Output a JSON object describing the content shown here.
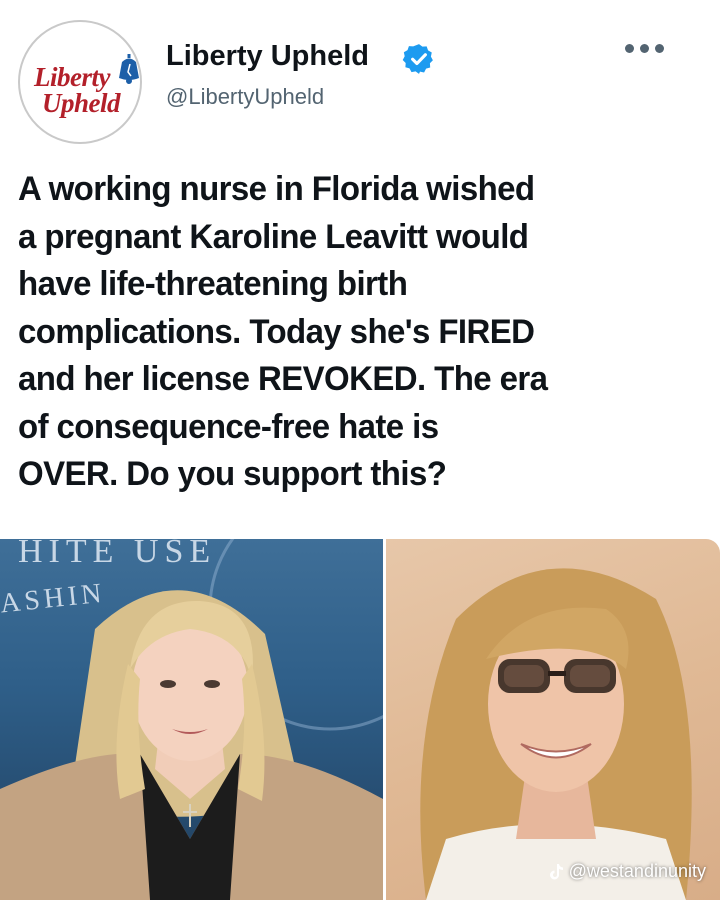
{
  "account": {
    "display_name": "Liberty Upheld",
    "handle": "@LibertyUpheld",
    "logo_text": [
      "Liberty",
      "Upheld"
    ],
    "verified": true,
    "more_icon": "more-horizontal-icon"
  },
  "tweet": {
    "text_lines": [
      "A working nurse in Florida wished",
      "a pregnant Karoline Leavitt would",
      "have life-threatening birth",
      "complications. Today she's FIRED",
      "and her license REVOKED. The era",
      "of consequence-free hate is",
      "OVER. Do you support this?"
    ]
  },
  "media": {
    "left_photo": {
      "background_text_top": "HITE    USE",
      "background_text_side": "ASHIN"
    },
    "right_photo": {},
    "watermark": "@westandinunity"
  },
  "colors": {
    "brand_red": "#b3202a",
    "brand_blue": "#1d5fa8",
    "verified_blue": "#1d9bf0",
    "text_primary": "#0f1419",
    "text_secondary": "#536471"
  }
}
